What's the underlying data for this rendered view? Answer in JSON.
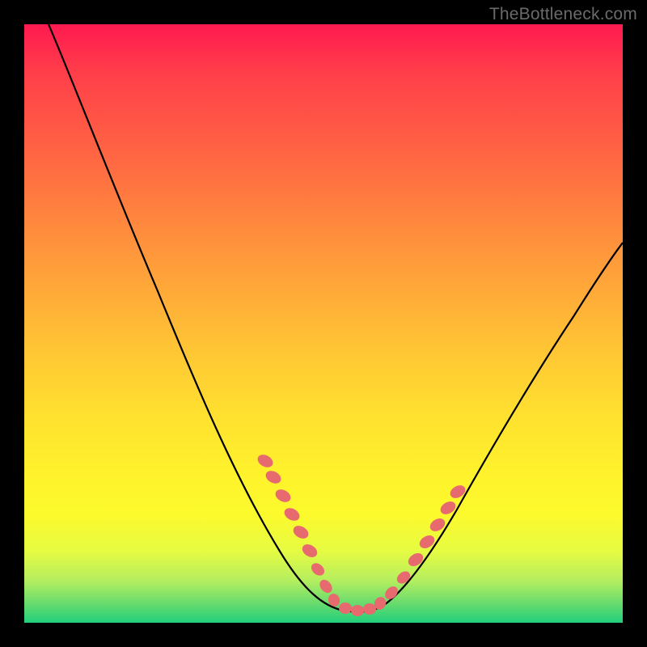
{
  "watermark": "TheBottleneck.com",
  "colors": {
    "curve": "#000000",
    "dots": "#e76a6f",
    "gradient_top": "#ff1a50",
    "gradient_bottom": "#21cf7b",
    "frame": "#000000"
  },
  "chart_data": {
    "type": "line",
    "title": "",
    "xlabel": "",
    "ylabel": "",
    "xlim": [
      0,
      100
    ],
    "ylim": [
      0,
      100
    ],
    "grid": false,
    "legend": false,
    "annotations": [
      "TheBottleneck.com"
    ],
    "series": [
      {
        "name": "bottleneck-curve",
        "x": [
          4,
          8,
          12,
          16,
          20,
          24,
          28,
          32,
          36,
          40,
          44,
          48,
          50,
          52,
          54,
          56,
          58,
          60,
          64,
          68,
          72,
          76,
          80,
          84,
          88,
          92,
          96,
          100
        ],
        "y": [
          100,
          93,
          85,
          77,
          69,
          61,
          53,
          45,
          37,
          29,
          21,
          13,
          8,
          5,
          3,
          2,
          2,
          3,
          6,
          10,
          15,
          20,
          26,
          32,
          38,
          45,
          52,
          60
        ]
      }
    ],
    "highlight_points": {
      "name": "highlighted-dots",
      "x": [
        40,
        41.5,
        43,
        44.5,
        47,
        49,
        50.5,
        52,
        54,
        55.5,
        57,
        58.5,
        61,
        63,
        65,
        67,
        68.5,
        70
      ],
      "y": [
        27,
        24,
        21,
        18,
        14,
        10,
        7.5,
        5.5,
        3.5,
        2.5,
        2,
        2.2,
        3.5,
        5.5,
        8,
        11,
        13.5,
        16
      ]
    }
  }
}
